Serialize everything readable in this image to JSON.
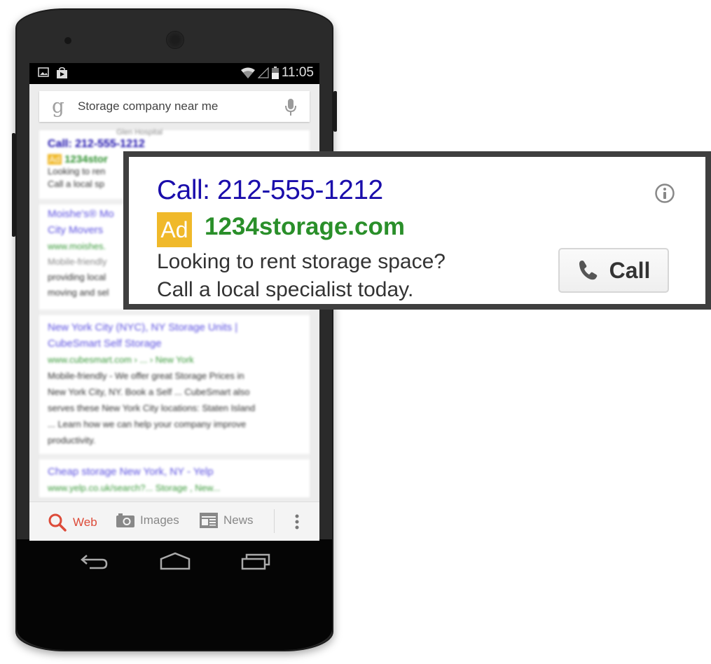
{
  "status_bar": {
    "left_icons": [
      "gallery-icon",
      "play-store-icon"
    ],
    "right_icons": [
      "wifi-icon",
      "signal-icon",
      "battery-icon"
    ],
    "time": "11:05"
  },
  "search": {
    "logo": "g",
    "query": "Storage company near me",
    "mic_icon": "microphone-icon"
  },
  "results": {
    "ad_preview": {
      "title": "Call: 212-555-1212",
      "badge": "Ad",
      "url": "1234stor",
      "line1": "Looking to ren",
      "line2": "Call a local sp"
    },
    "items": [
      {
        "title_line1": "Moishe's® Mo",
        "title_line2": "City Movers",
        "url": "www.moishes.",
        "lines": [
          "Mobile-friendly",
          "providing local",
          "moving and sel"
        ]
      },
      {
        "title_line1": "New York City (NYC), NY Storage Units |",
        "title_line2": "CubeSmart Self Storage",
        "url": "www.cubesmart.com › ... › New York",
        "lines": [
          "Mobile-friendly - We offer great Storage Prices in",
          "New York City, NY. Book a Self ... CubeSmart also",
          "serves these New York City locations: Staten Island",
          "... Learn how we can help your company improve",
          "productivity."
        ]
      },
      {
        "title_line1": "Cheap storage New York, NY - Yelp",
        "url": "www.yelp.co.uk/search?... Storage , New..."
      }
    ]
  },
  "bottom_nav": {
    "items": [
      {
        "label": "Web",
        "icon": "search-icon",
        "active": true
      },
      {
        "label": "Images",
        "icon": "camera-icon",
        "active": false
      },
      {
        "label": "News",
        "icon": "newspaper-icon",
        "active": false
      }
    ],
    "more_icon": "overflow-menu-icon"
  },
  "softkeys": [
    "back-icon",
    "home-icon",
    "recent-apps-icon"
  ],
  "ad_callout": {
    "title": "Call: 212-555-1212",
    "badge": "Ad",
    "url": "1234storage.com",
    "desc_line1": "Looking to rent storage space?",
    "desc_line2": "Call a local specialist today.",
    "call_button_label": "Call",
    "info_icon": "info-icon"
  },
  "colors": {
    "ad_title": "#1a0dab",
    "ad_url": "#2a8f2a",
    "ad_badge": "#f0b92a",
    "nav_active": "#dd4b39"
  }
}
